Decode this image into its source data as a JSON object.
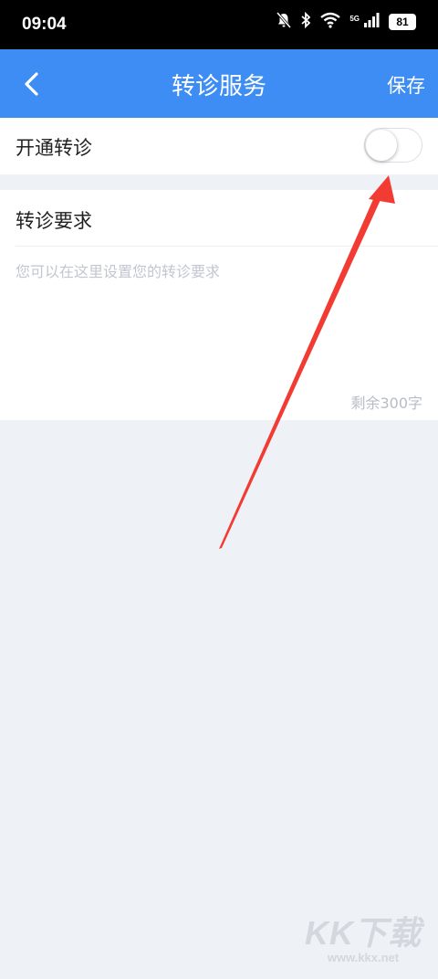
{
  "status_bar": {
    "time": "09:04",
    "network_label": "5G",
    "battery": "81"
  },
  "nav": {
    "title": "转诊服务",
    "save_label": "保存",
    "back_icon": "chevron-left-icon",
    "background_color": "#3d8df5"
  },
  "referral_toggle": {
    "label": "开通转诊",
    "enabled": false
  },
  "requirements": {
    "title": "转诊要求",
    "placeholder": "您可以在这里设置您的转诊要求",
    "value": "",
    "remaining_label": "剩余300字"
  },
  "annotation": {
    "type": "red-arrow",
    "points_to": "referral-toggle-switch",
    "color": "#f13b33"
  },
  "watermark": {
    "logo": "KK下载",
    "url": "www.kkx.net"
  }
}
